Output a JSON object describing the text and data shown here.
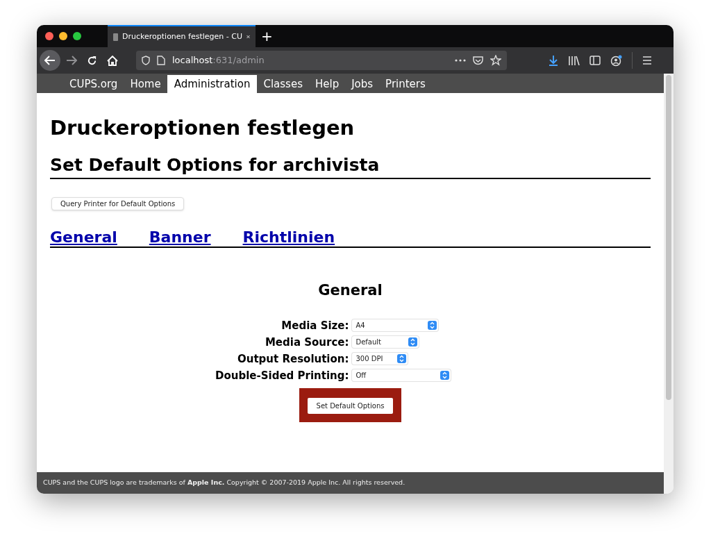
{
  "browser": {
    "tab_title": "Druckeroptionen festlegen - CU",
    "new_tab": "+",
    "url_host": "localhost",
    "url_path": ":631/admin"
  },
  "nav": [
    {
      "label": "CUPS.org",
      "selected": false
    },
    {
      "label": "Home",
      "selected": false
    },
    {
      "label": "Administration",
      "selected": true
    },
    {
      "label": "Classes",
      "selected": false
    },
    {
      "label": "Help",
      "selected": false
    },
    {
      "label": "Jobs",
      "selected": false
    },
    {
      "label": "Printers",
      "selected": false
    }
  ],
  "page_title": "Druckeroptionen festlegen",
  "subtitle": "Set Default Options for archivista",
  "query_button": "Query Printer for Default Options",
  "section_tabs": [
    "General",
    "Banner",
    "Richtlinien"
  ],
  "section_heading": "General",
  "options": [
    {
      "label": "Media Size:",
      "value": "A4"
    },
    {
      "label": "Media Source:",
      "value": "Default"
    },
    {
      "label": "Output Resolution:",
      "value": "300 DPI"
    },
    {
      "label": "Double-Sided Printing:",
      "value": "Off"
    }
  ],
  "submit": {
    "label": "Set Default Options",
    "highlighted": true
  },
  "footer": "CUPS and the CUPS logo are trademarks of **Apple Inc.** Copyright © 2007-2019 Apple Inc. All rights reserved."
}
